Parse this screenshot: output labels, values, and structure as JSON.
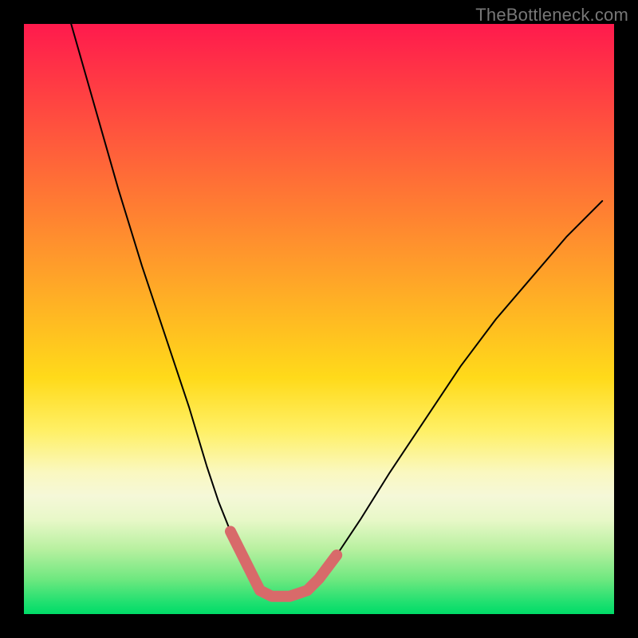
{
  "watermark": "TheBottleneck.com",
  "chart_data": {
    "type": "line",
    "title": "",
    "xlabel": "",
    "ylabel": "",
    "xlim": [
      0,
      100
    ],
    "ylim": [
      0,
      100
    ],
    "grid": false,
    "series": [
      {
        "name": "curve",
        "color": "#000000",
        "x": [
          8,
          12,
          16,
          20,
          24,
          28,
          31,
          33,
          35,
          37,
          39,
          40,
          42,
          45,
          48,
          50,
          53,
          57,
          62,
          68,
          74,
          80,
          86,
          92,
          98
        ],
        "y": [
          100,
          86,
          72,
          59,
          47,
          35,
          25,
          19,
          14,
          10,
          6,
          4,
          3,
          3,
          4,
          6,
          10,
          16,
          24,
          33,
          42,
          50,
          57,
          64,
          70
        ]
      },
      {
        "name": "highlight",
        "color": "#d86a6a",
        "x": [
          35,
          37,
          39,
          40,
          42,
          45,
          48,
          50,
          53
        ],
        "y": [
          14,
          10,
          6,
          4,
          3,
          3,
          4,
          6,
          10
        ]
      }
    ]
  }
}
